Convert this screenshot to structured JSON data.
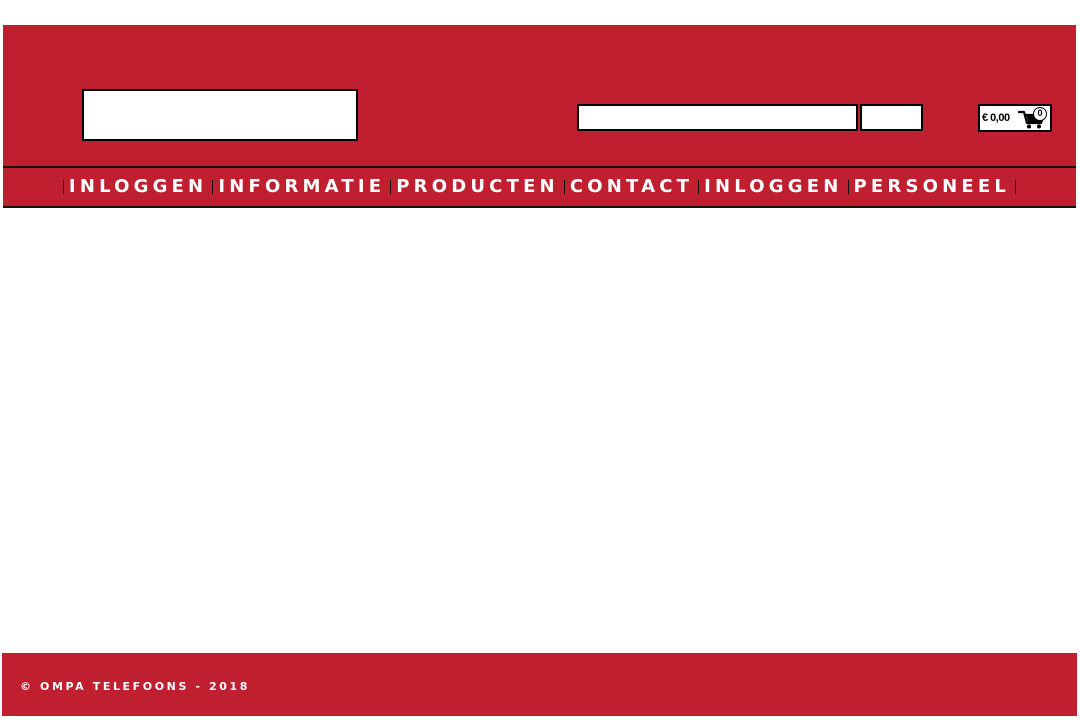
{
  "colors": {
    "brand_red": "#c01f2f",
    "text_on_brand": "#ffffff",
    "border": "#000000"
  },
  "header": {
    "logo": {
      "alt": ""
    },
    "search": {
      "value": "",
      "placeholder": "",
      "button_label": ""
    },
    "cart": {
      "total": "€ 0,00",
      "count": "0",
      "icon": "shopping-cart-icon"
    }
  },
  "nav": {
    "items": [
      {
        "label": "INLOGGEN"
      },
      {
        "label": "INFORMATIE"
      },
      {
        "label": "PRODUCTEN"
      },
      {
        "label": "CONTACT"
      },
      {
        "label": "INLOGGEN"
      },
      {
        "label": "PERSONEEL"
      }
    ]
  },
  "footer": {
    "copyright": "© OMPA TELEFOONS - 2018"
  }
}
